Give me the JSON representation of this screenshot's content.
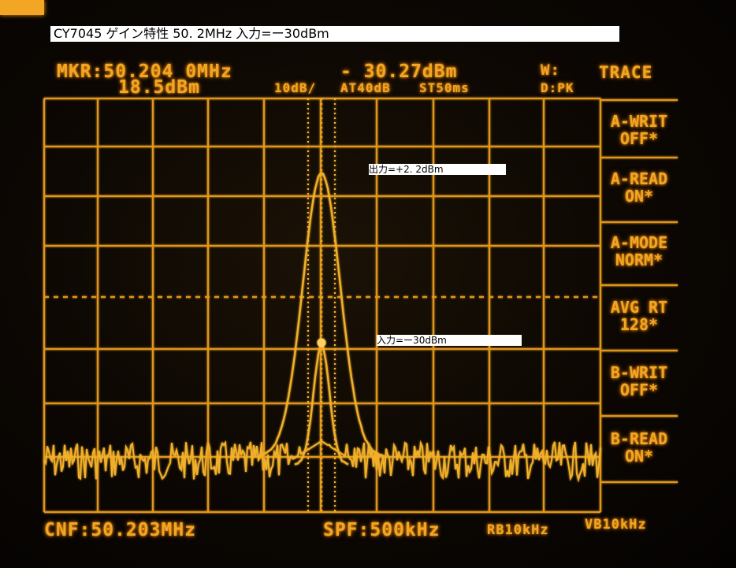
{
  "title_label": "CY7045  ゲイン特性  50. 2MHz  入力=ー30dBm",
  "annotations": {
    "output": "出力=+2. 2dBm",
    "input": "入力=ー30dBm"
  },
  "header": {
    "marker_freq": "MKR:50.204 0MHz",
    "marker_level": "- 30.27dBm",
    "w_label": "W:",
    "ref_level": "18.5dBm",
    "scale": "10dB/",
    "attenuation": "AT40dB",
    "sweep_time": "ST50ms",
    "detector": "D:PK"
  },
  "softkeys": {
    "title": "TRACE",
    "items": [
      {
        "line1": "A-WRIT",
        "line2": "OFF*"
      },
      {
        "line1": "A-READ",
        "line2": "ON*"
      },
      {
        "line1": "A-MODE",
        "line2": "NORM*"
      },
      {
        "line1": "AVG RT",
        "line2": "128*"
      },
      {
        "line1": "B-WRIT",
        "line2": "OFF*"
      },
      {
        "line1": "B-READ",
        "line2": "ON*"
      }
    ]
  },
  "footer": {
    "center_freq": "CNF:50.203MHz",
    "span": "SPF:500kHz",
    "rbw": "RB10kHz",
    "vbw": "VB10kHz"
  },
  "colors": {
    "trace": "#f2b02a",
    "grid": "#e0961e"
  }
}
